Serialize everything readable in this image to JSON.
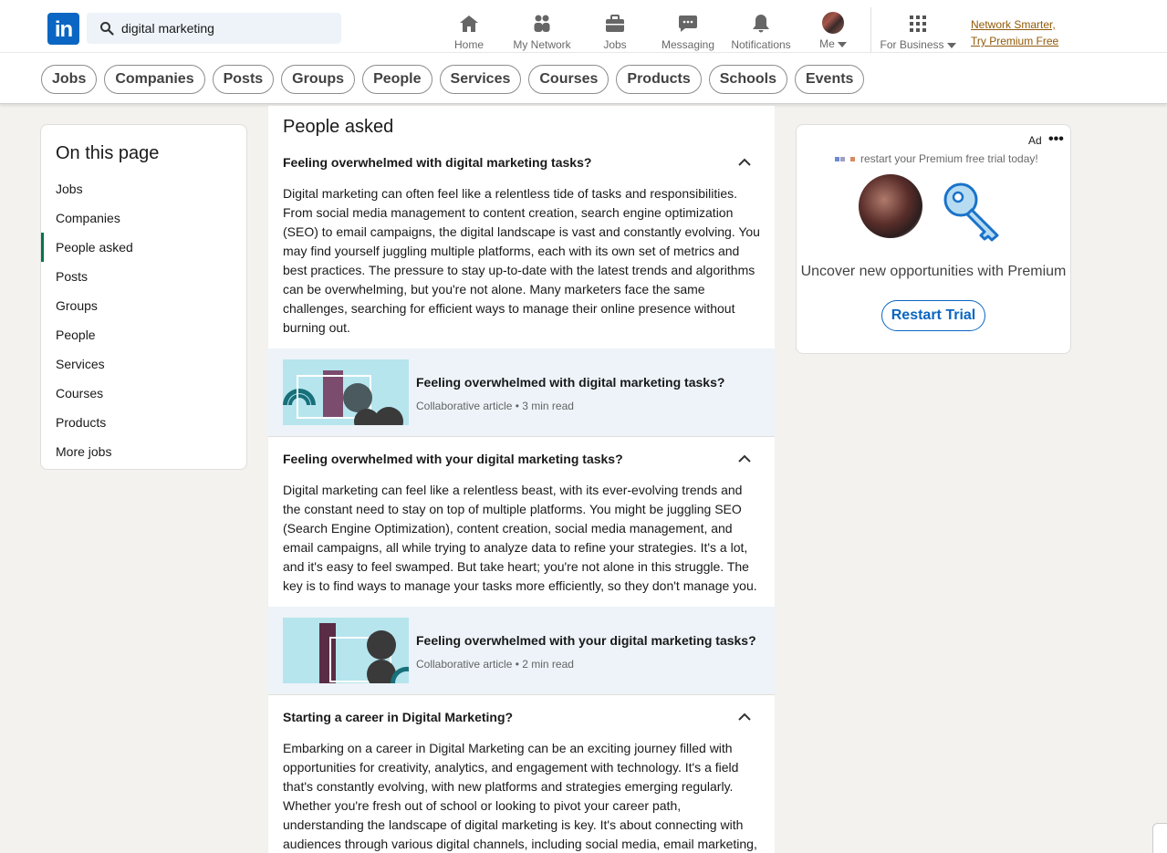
{
  "nav": {
    "search_value": "digital marketing",
    "items": [
      {
        "label": "Home",
        "icon": "home-icon"
      },
      {
        "label": "My Network",
        "icon": "people-icon"
      },
      {
        "label": "Jobs",
        "icon": "briefcase-icon"
      },
      {
        "label": "Messaging",
        "icon": "chat-icon"
      },
      {
        "label": "Notifications",
        "icon": "bell-icon"
      },
      {
        "label": "Me",
        "icon": "avatar"
      },
      {
        "label": "For Business",
        "icon": "grid-icon"
      }
    ],
    "premium_line1": "Network Smarter,",
    "premium_line2": "Try Premium Free"
  },
  "filters": [
    "Jobs",
    "Companies",
    "Posts",
    "Groups",
    "People",
    "Services",
    "Courses",
    "Products",
    "Schools",
    "Events"
  ],
  "on_this_page": {
    "title": "On this page",
    "items": [
      "Jobs",
      "Companies",
      "People asked",
      "Posts",
      "Groups",
      "People",
      "Services",
      "Courses",
      "Products",
      "More jobs"
    ],
    "active": "People asked"
  },
  "people_asked": {
    "title": "People asked",
    "questions": [
      {
        "question": "Feeling overwhelmed with digital marketing tasks?",
        "answer": "Digital marketing can often feel like a relentless tide of tasks and responsibilities. From social media management to content creation, search engine optimization (SEO) to email campaigns, the digital landscape is vast and constantly evolving. You may find yourself juggling multiple platforms, each with its own set of metrics and best practices. The pressure to stay up-to-date with the latest trends and algorithms can be overwhelming, but you're not alone. Many marketers face the same challenges, searching for efficient ways to manage their online presence without burning out.",
        "article_title": "Feeling overwhelmed with digital marketing tasks?",
        "article_meta": "Collaborative article • 3 min read"
      },
      {
        "question": "Feeling overwhelmed with your digital marketing tasks?",
        "answer": "Digital marketing can feel like a relentless beast, with its ever-evolving trends and the constant need to stay on top of multiple platforms. You might be juggling SEO (Search Engine Optimization), content creation, social media management, and email campaigns, all while trying to analyze data to refine your strategies. It's a lot, and it's easy to feel swamped. But take heart; you're not alone in this struggle. The key is to find ways to manage your tasks more efficiently, so they don't manage you.",
        "article_title": "Feeling overwhelmed with your digital marketing tasks?",
        "article_meta": "Collaborative article • 2 min read"
      },
      {
        "question": "Starting a career in Digital Marketing?",
        "answer": "Embarking on a career in Digital Marketing can be an exciting journey filled with opportunities for creativity, analytics, and engagement with technology. It's a field that's constantly evolving, with new platforms and strategies emerging regularly. Whether you're fresh out of school or looking to pivot your career path, understanding the landscape of digital marketing is key. It's about connecting with audiences through various digital channels, including social media, email marketing,"
      }
    ]
  },
  "ad": {
    "label": "Ad",
    "subtitle": "restart your Premium free trial today!",
    "text": "Uncover new opportunities with Premium",
    "button": "Restart Trial"
  },
  "colors": {
    "brand": "#0a66c2",
    "premium": "#915907",
    "active_indicator": "#01754f"
  }
}
